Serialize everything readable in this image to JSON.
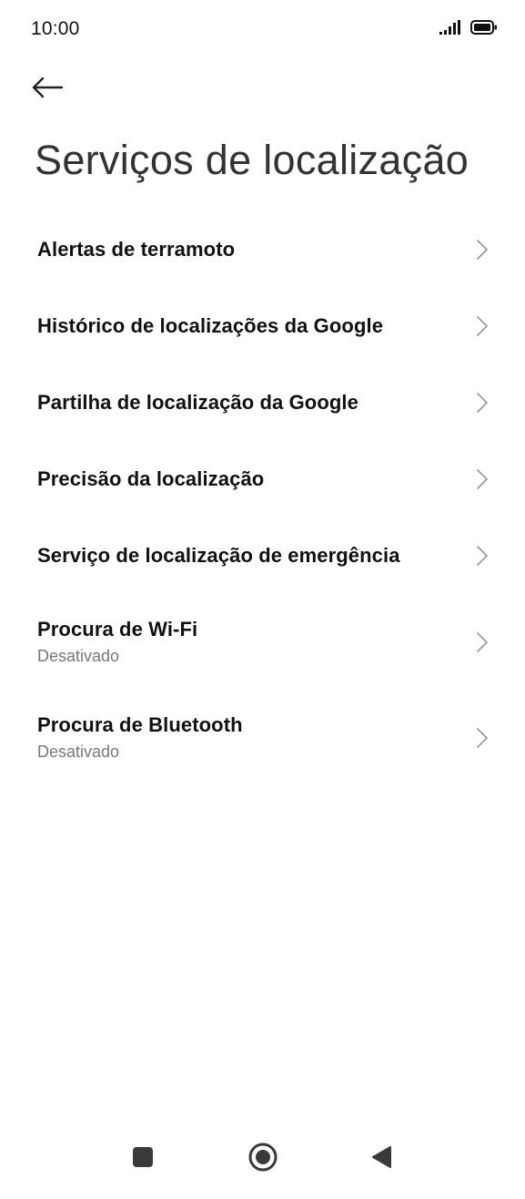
{
  "status_bar": {
    "time": "10:00",
    "signal_icon": "signal-bars-icon",
    "battery_icon": "battery-icon"
  },
  "header": {
    "back_icon": "back-arrow-icon",
    "title": "Serviços de localização"
  },
  "settings": {
    "items": [
      {
        "title": "Alertas de terramoto",
        "subtitle": ""
      },
      {
        "title": "Histórico de localizações da Google",
        "subtitle": ""
      },
      {
        "title": "Partilha de localização da Google",
        "subtitle": ""
      },
      {
        "title": "Precisão da localização",
        "subtitle": ""
      },
      {
        "title": "Serviço de localização de emergência",
        "subtitle": ""
      },
      {
        "title": "Procura de Wi-Fi",
        "subtitle": "Desativado"
      },
      {
        "title": "Procura de Bluetooth",
        "subtitle": "Desativado"
      }
    ]
  },
  "nav_bar": {
    "recents_icon": "square-recents-icon",
    "home_icon": "circle-home-icon",
    "back_icon": "triangle-back-icon"
  },
  "colors": {
    "background": "#ffffff",
    "text_primary": "#111111",
    "text_secondary": "#777777",
    "chevron": "#9a9a9a",
    "nav_icons": "#3a3a3a"
  }
}
